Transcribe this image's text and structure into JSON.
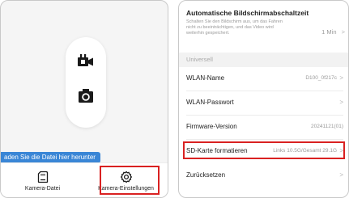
{
  "left_screen": {
    "tooltip_text": "aden Sie die Datei hier herunter",
    "tabs": [
      {
        "label": "Kamera-Datei",
        "icon": "sd-card-icon"
      },
      {
        "label": "Kamera-Einstellungen",
        "icon": "gear-icon"
      }
    ],
    "mode_buttons": [
      "video-camera-icon",
      "photo-camera-icon"
    ],
    "highlight_color": "#d92121"
  },
  "right_screen": {
    "autolock": {
      "title": "Automatische Bildschirmabschaltzeit",
      "description": "Schalten Sie den Bildschirm aus, um das Fahren nicht zu beeinträchtigen, und das Video wird weiterhin gespeichert.",
      "value": "1 Min"
    },
    "section_header": "Universell",
    "rows": [
      {
        "label": "WLAN-Name",
        "value": "D100_0f217c"
      },
      {
        "label": "WLAN-Passwort",
        "value": ""
      },
      {
        "label": "Firmware-Version",
        "value": "20241121(01)"
      },
      {
        "label": "SD-Karte formatieren",
        "value": "Links 10.5G/Gesamt 29.1G"
      },
      {
        "label": "Zurücksetzen",
        "value": ""
      }
    ],
    "chevron": ">"
  },
  "colors": {
    "tooltip": "#3a86d6",
    "highlight": "#d92121",
    "secondary_text": "#9a9a9a"
  }
}
